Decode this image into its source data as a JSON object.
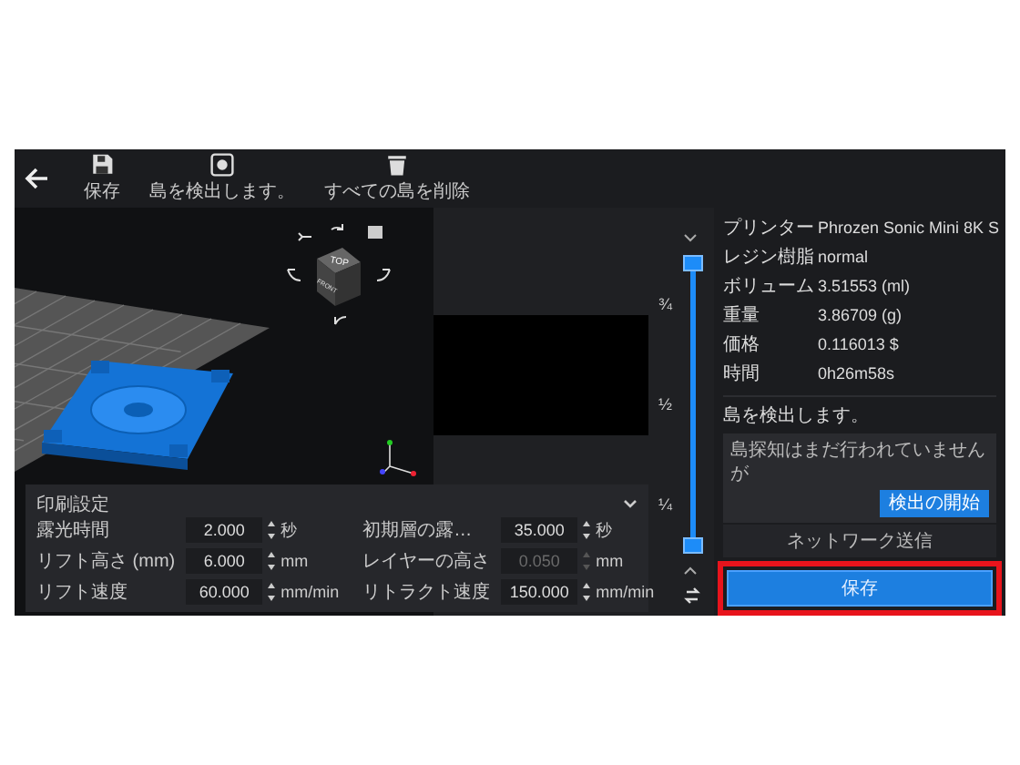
{
  "toolbar": {
    "buttons": [
      {
        "kind": "save",
        "label": "保存"
      },
      {
        "kind": "detect",
        "label": "島を検出します。"
      },
      {
        "kind": "delete",
        "label": "すべての島を削除"
      }
    ]
  },
  "view_cube": {
    "top": "TOP",
    "front": "FRONT"
  },
  "print_settings": {
    "title": "印刷設定",
    "expanded": true,
    "fields": [
      {
        "label": "露光時間",
        "value": "2.000",
        "unit": "秒",
        "disabled": false
      },
      {
        "label": "初期層の露…",
        "value": "35.000",
        "unit": "秒",
        "disabled": false
      },
      {
        "label": "リフト高さ (mm)",
        "value": "6.000",
        "unit": "mm",
        "disabled": false
      },
      {
        "label": "レイヤーの高さ",
        "value": "0.050",
        "unit": "mm",
        "disabled": true
      },
      {
        "label": "リフト速度",
        "value": "60.000",
        "unit": "mm/min",
        "disabled": false
      },
      {
        "label": "リトラクト速度",
        "value": "150.000",
        "unit": "mm/min",
        "disabled": false
      }
    ]
  },
  "layer_slider": {
    "marks": [
      "¾",
      "½",
      "¼"
    ],
    "thumbs": [
      {
        "level": 1
      },
      {
        "level": 0
      }
    ]
  },
  "info": [
    {
      "label": "プリンター",
      "value": "Phrozen Sonic Mini 8K S"
    },
    {
      "label": "レジン樹脂",
      "value": "normal"
    },
    {
      "label": "ボリューム",
      "value": "3.51553 (ml)"
    },
    {
      "label": "重量",
      "value": "3.86709 (g)"
    },
    {
      "label": "価格",
      "value": "0.116013 $"
    },
    {
      "label": "時間",
      "value": "0h26m58s"
    }
  ],
  "island_detection": {
    "title": "島を検出します。",
    "message": "島探知はまだ行われていませんが",
    "button": "検出の開始"
  },
  "network_button": "ネットワーク送信",
  "save_button": {
    "label": "保存",
    "highlighted": true
  }
}
